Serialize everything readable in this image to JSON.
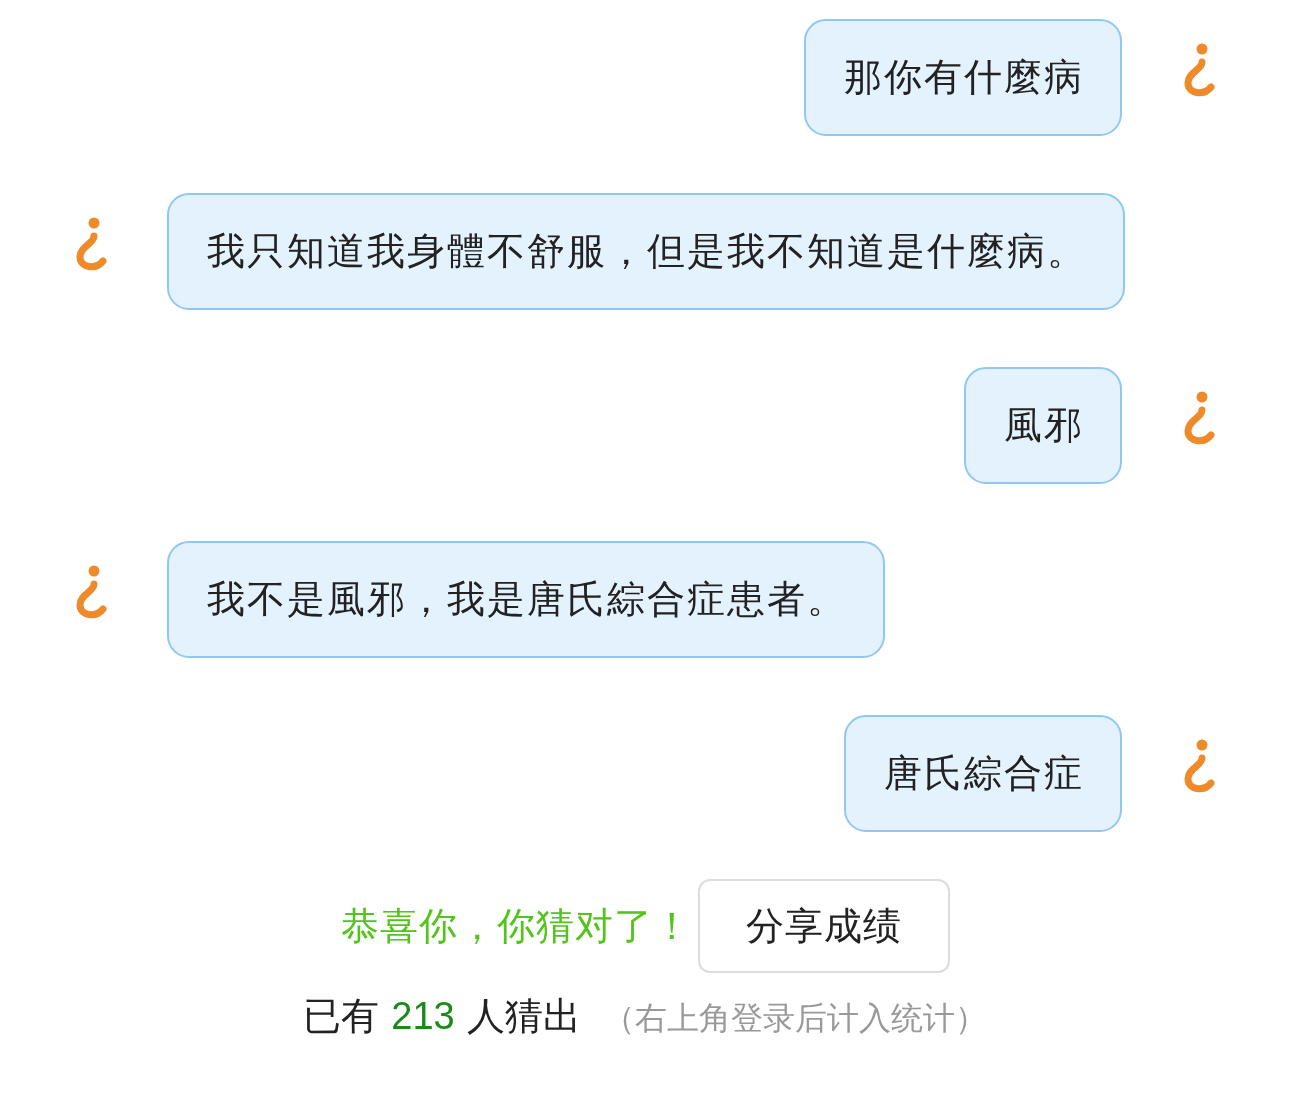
{
  "messages": [
    {
      "kind": "outgoing",
      "text": "那你有什麼病"
    },
    {
      "kind": "incoming",
      "text": "我只知道我身體不舒服，但是我不知道是什麼病。"
    },
    {
      "kind": "outgoing",
      "text": "風邪"
    },
    {
      "kind": "incoming",
      "text": "我不是風邪，我是唐氏綜合症患者。"
    },
    {
      "kind": "outgoing",
      "text": "唐氏綜合症"
    }
  ],
  "result": {
    "message": "恭喜你，你猜对了！",
    "share_button": "分享成绩"
  },
  "stats": {
    "prefix": "已有",
    "count": "213",
    "suffix": "人猜出",
    "note": "（右上角登录后计入统计）"
  }
}
